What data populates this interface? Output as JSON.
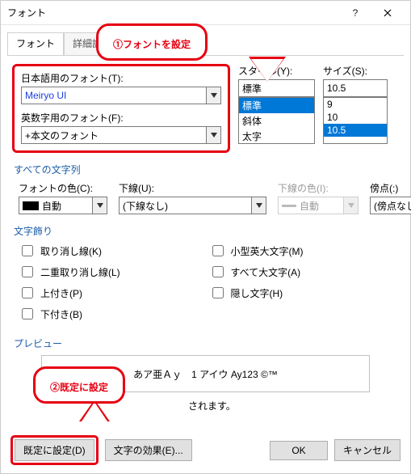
{
  "title": "フォント",
  "tabs": {
    "font": "フォント",
    "advanced": "詳細設定"
  },
  "font_section": {
    "jp_label": "日本語用のフォント(T):",
    "jp_value": "Meiryo UI",
    "en_label": "英数字用のフォント(F):",
    "en_value": "+本文のフォント"
  },
  "style": {
    "label": "スタイル(Y):",
    "value": "標準",
    "options": [
      "標準",
      "斜体",
      "太字"
    ]
  },
  "size": {
    "label": "サイズ(S):",
    "value": "10.5",
    "options": [
      "9",
      "10",
      "10.5"
    ]
  },
  "all_text": {
    "header": "すべての文字列",
    "color_label": "フォントの色(C):",
    "color_value": "自動",
    "underline_label": "下線(U):",
    "underline_value": "(下線なし)",
    "underline_color_label": "下線の色(I):",
    "underline_color_value": "自動",
    "emphasis_label": "傍点(:)",
    "emphasis_value": "(傍点なし)"
  },
  "decor": {
    "header": "文字飾り",
    "strike": "取り消し線(K)",
    "dstrike": "二重取り消し線(L)",
    "sup": "上付き(P)",
    "sub": "下付き(B)",
    "smallcaps": "小型英大文字(M)",
    "allcaps": "すべて大文字(A)",
    "hidden": "隠し文字(H)"
  },
  "preview": {
    "header": "プレビュー",
    "sample": "あア亜Ａｙ　1  アイウ Ay123 ©™",
    "note_suffix": "されます。"
  },
  "buttons": {
    "default": "既定に設定(D)",
    "effects": "文字の効果(E)...",
    "ok": "OK",
    "cancel": "キャンセル"
  },
  "callouts": {
    "c1": "①フォントを設定",
    "c2": "②既定に設定"
  }
}
